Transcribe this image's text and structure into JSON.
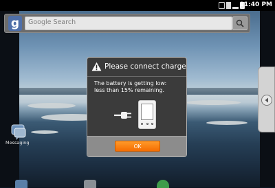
{
  "status_bar": {
    "time": "11:40 PM",
    "icons": [
      "usb-icon",
      "sd-card-icon",
      "signal-bars-icon",
      "battery-icon"
    ]
  },
  "search_widget": {
    "logo": "g",
    "placeholder": "Google Search",
    "button_icon": "magnifier-icon"
  },
  "desktop": {
    "messaging_label": "Messaging"
  },
  "dialog": {
    "title": "Please connect charger",
    "message_lines": [
      "The battery is getting low:",
      "less than 15% remaining."
    ],
    "ok_label": "OK",
    "accent": "#f57d0f"
  }
}
